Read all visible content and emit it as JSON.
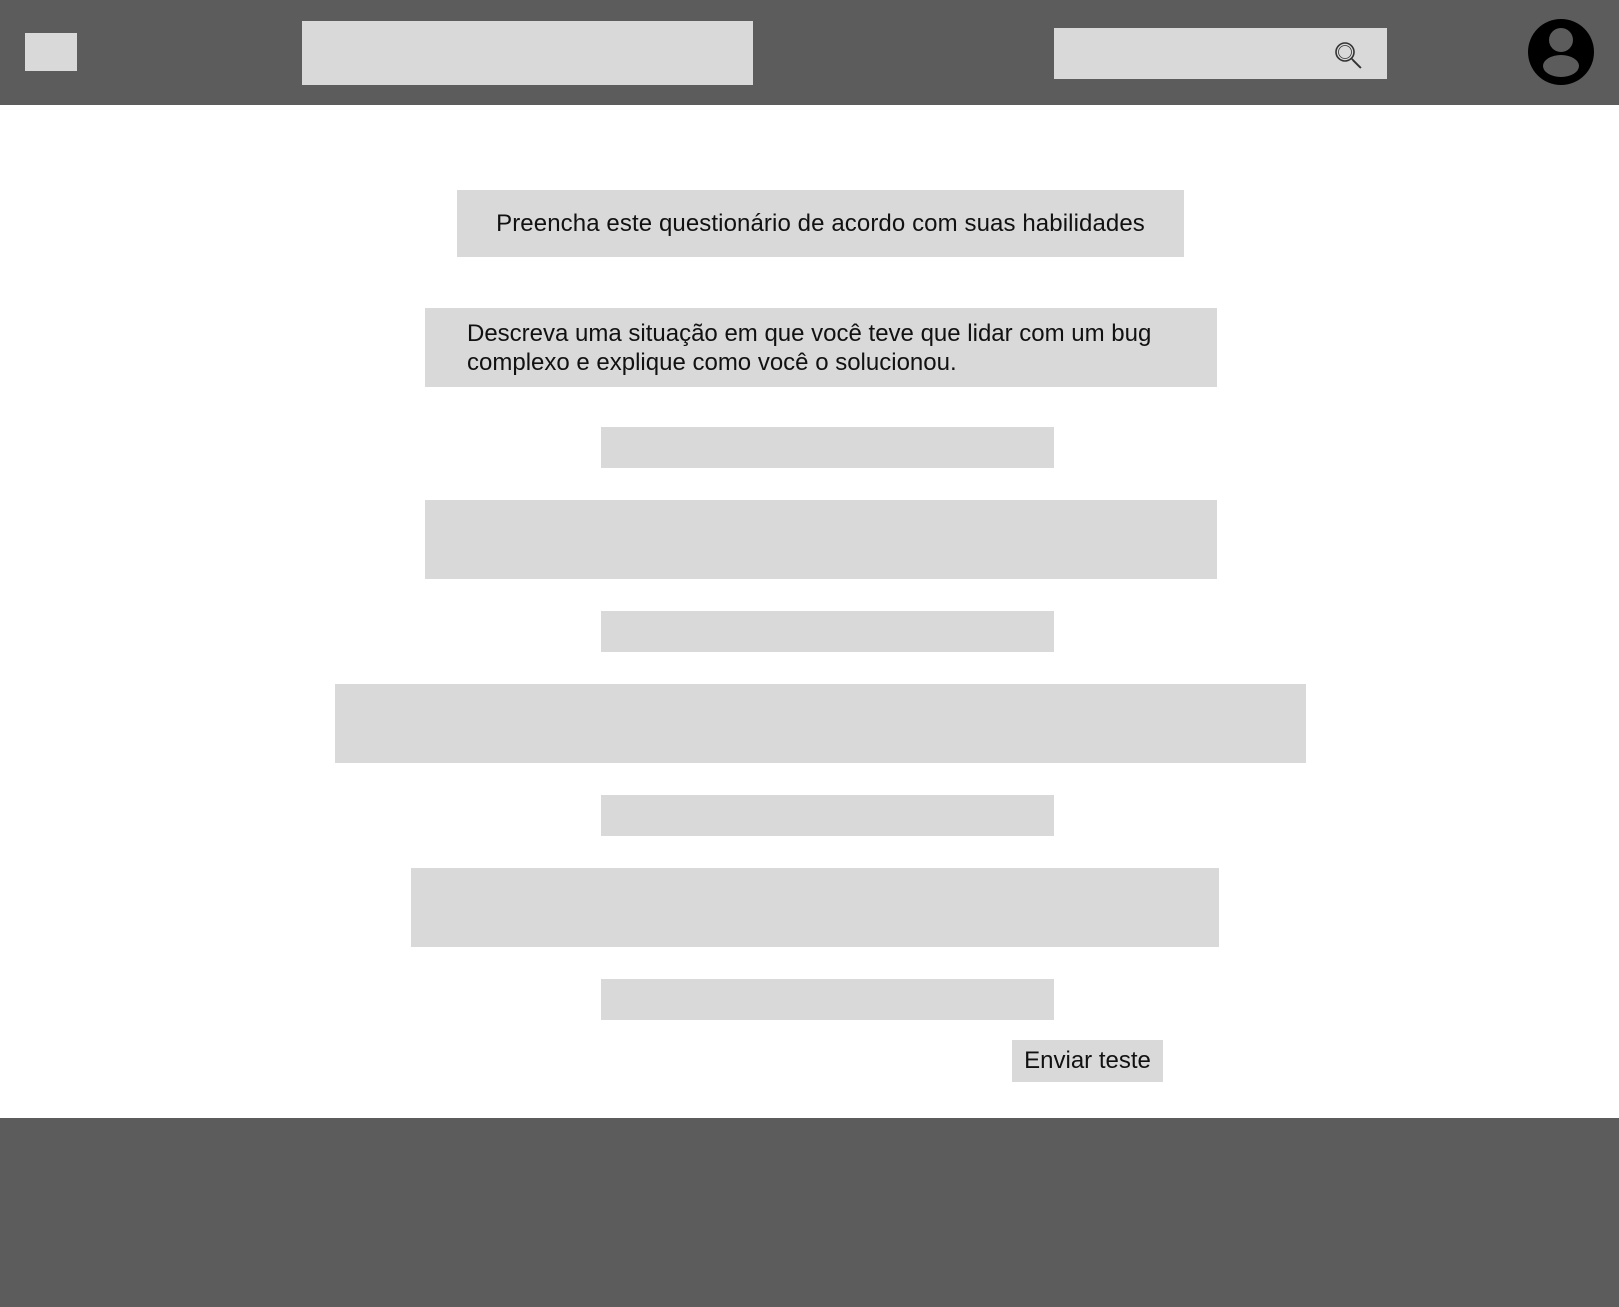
{
  "header": {
    "logo_icon": "logo-placeholder",
    "search": {
      "placeholder": "",
      "icon": "search-icon"
    },
    "profile_icon": "user-avatar-icon"
  },
  "main": {
    "title": "Preencha este questionário de acordo com suas habilidades",
    "question": "Descreva uma situação em que você teve que lidar com um bug complexo e explique como você o solucionou.",
    "submit_label": "Enviar teste"
  },
  "colors": {
    "header_footer": "#5c5c5c",
    "placeholder": "#d9d9d9",
    "background": "#ffffff"
  }
}
